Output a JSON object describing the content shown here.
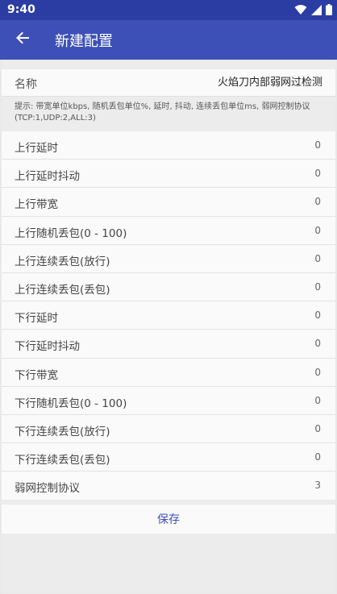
{
  "status_bar": {
    "time": "9:40"
  },
  "app_bar": {
    "title": "新建配置"
  },
  "name_field": {
    "label": "名称",
    "value": "火焰刀内部弱网过检测"
  },
  "hint": "提示: 带宽单位kbps, 随机丢包单位%, 延时, 抖动, 连续丢包单位ms, 弱网控制协议(TCP:1,UDP:2,ALL:3)",
  "settings": [
    {
      "label": "上行延时",
      "value": "0"
    },
    {
      "label": "上行延时抖动",
      "value": "0"
    },
    {
      "label": "上行带宽",
      "value": "0"
    },
    {
      "label": "上行随机丢包(0 - 100)",
      "value": "0"
    },
    {
      "label": "上行连续丢包(放行)",
      "value": "0"
    },
    {
      "label": "上行连续丢包(丢包)",
      "value": "0"
    },
    {
      "label": "下行延时",
      "value": "0"
    },
    {
      "label": "下行延时抖动",
      "value": "0"
    },
    {
      "label": "下行带宽",
      "value": "0"
    },
    {
      "label": "下行随机丢包(0 - 100)",
      "value": "0"
    },
    {
      "label": "下行连续丢包(放行)",
      "value": "0"
    },
    {
      "label": "下行连续丢包(丢包)",
      "value": "0"
    },
    {
      "label": "弱网控制协议",
      "value": "3"
    }
  ],
  "save_label": "保存",
  "icons": {
    "back": "arrow-left-icon",
    "wifi": "wifi-icon",
    "signal": "cell-signal-icon",
    "battery": "battery-icon"
  },
  "colors": {
    "app_bar": "#3d50b7",
    "status_bar": "#2b3da3",
    "accent": "#3d50b7"
  }
}
